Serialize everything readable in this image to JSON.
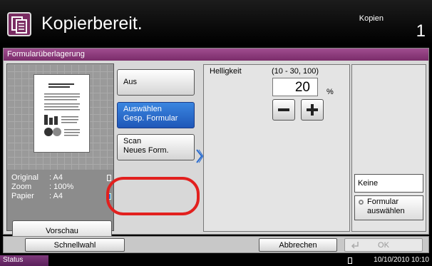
{
  "header": {
    "app_icon": "copy-document-icon",
    "title": "Kopierbereit.",
    "mode_label": "Kopien",
    "copy_count": "1"
  },
  "panel": {
    "title": "Formularüberlagerung",
    "preview": {
      "info": [
        {
          "label": "Original",
          "value": ": A4",
          "icon": "paper-size-icon"
        },
        {
          "label": "Zoom",
          "value": ": 100%",
          "icon": ""
        },
        {
          "label": "Papier",
          "value": ": A4",
          "icon": "paper-tray-icon"
        }
      ],
      "preview_button": "Vorschau"
    },
    "options": {
      "aus": "Aus",
      "select_stored_line1": "Auswählen",
      "select_stored_line2": "Gesp. Formular",
      "scan_new_line1": "Scan",
      "scan_new_line2": "Neues Form."
    },
    "brightness": {
      "label": "Helligkeit",
      "range": "(10 - 30, 100)",
      "value": "20",
      "unit": "%"
    },
    "side": {
      "keine": "Keine",
      "formular_line1": "Formular",
      "formular_line2": "auswählen"
    }
  },
  "bottom": {
    "quick": "Schnellwahl",
    "cancel": "Abbrechen",
    "ok": "OK"
  },
  "status": {
    "button": "Status",
    "datetime": "10/10/2010  10:10"
  },
  "colors": {
    "accent": "#7a2c6a",
    "selected": "#2a6ccf",
    "highlight": "#e2201e"
  }
}
